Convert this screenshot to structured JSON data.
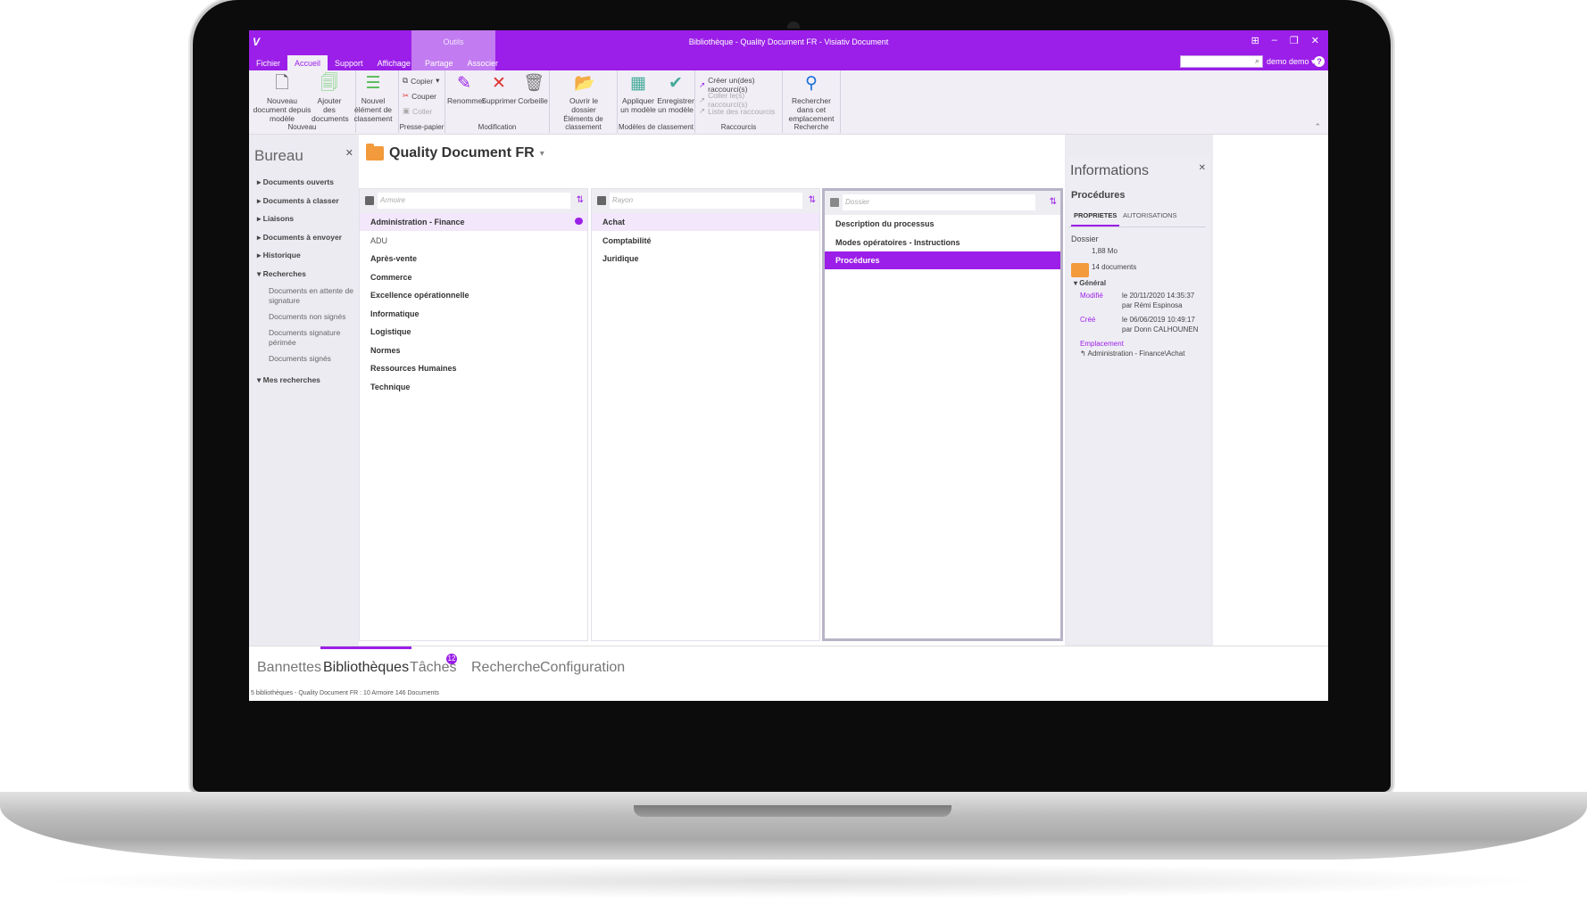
{
  "app": {
    "window_title": "Bibliothèque - Quality Document FR - Visiativ Document",
    "logo": "V",
    "tools_context": "Outils",
    "tabs": [
      "Fichier",
      "Accueil",
      "Support",
      "Affichage",
      "Partage",
      "Associer"
    ],
    "active_tab": "Accueil",
    "user": "demo demo",
    "help": "?"
  },
  "ribbon": {
    "groups": [
      {
        "label": "Nouveau",
        "buttons": [
          "Nouveau document depuis modèle",
          "Ajouter des documents",
          "Nouvel élément de classement"
        ]
      },
      {
        "label": "Presse-papier",
        "items": [
          "Copier",
          "Couper",
          "Coller"
        ]
      },
      {
        "label": "Modification",
        "buttons": [
          "Renommer",
          "Supprimer",
          "Corbeille"
        ]
      },
      {
        "label": "Éléments de classement",
        "buttons": [
          "Ouvrir le dossier"
        ]
      },
      {
        "label": "Modèles de classement",
        "buttons": [
          "Appliquer un modèle",
          "Enregistrer un modèle"
        ]
      },
      {
        "label": "Raccourcis",
        "items": [
          "Créer un(des) raccourci(s)",
          "Coller le(s) raccourci(s)",
          "Liste des raccourcis"
        ]
      },
      {
        "label": "Recherche",
        "buttons": [
          "Rechercher dans cet emplacement"
        ]
      }
    ]
  },
  "bureau": {
    "title": "Bureau",
    "items": [
      "Documents ouverts",
      "Documents à classer",
      "Liaisons",
      "Documents à envoyer",
      "Historique",
      "Recherches"
    ],
    "recherches_sub": [
      "Documents en attente de signature",
      "Documents non signés",
      "Documents signature périmée",
      "Documents signés"
    ],
    "mes_recherches": "Mes recherches"
  },
  "library": {
    "title": "Quality Document FR",
    "columns": [
      {
        "placeholder": "Armoire",
        "items": [
          "Administration - Finance",
          "ADU",
          "Après-vente",
          "Commerce",
          "Excellence opérationnelle",
          "Informatique",
          "Logistique",
          "Normes",
          "Ressources Humaines",
          "Technique"
        ]
      },
      {
        "placeholder": "Rayon",
        "items": [
          "Achat",
          "Comptabilité",
          "Juridique"
        ]
      },
      {
        "placeholder": "Dossier",
        "items": [
          "Description du processus",
          "Modes opératoires - Instructions",
          "Procédures"
        ]
      }
    ]
  },
  "info": {
    "title": "Informations",
    "name": "Procédures",
    "tabs": [
      "PROPRIETES",
      "AUTORISATIONS"
    ],
    "type": "Dossier",
    "size": "1,88 Mo",
    "count": "14 documents",
    "section": "Général",
    "modified_label": "Modifié",
    "modified_date": "le 20/11/2020 14:35:37",
    "modified_by": "par Rémi Espinosa",
    "created_label": "Créé",
    "created_date": "le 06/06/2019 10:49:17",
    "created_by": "par Donn CALHOUNEN",
    "location_label": "Emplacement",
    "location": "Administration - Finance\\Achat"
  },
  "bottom_tabs": [
    "Bannettes",
    "Bibliothèques",
    "Tâches",
    "Recherche",
    "Configuration"
  ],
  "tasks_badge": "12",
  "status": "5 bibliothèques - Quality Document FR : 10 Armoire 146 Documents",
  "colors": {
    "accent": "#9b1fe8",
    "folder": "#f29a3c"
  }
}
